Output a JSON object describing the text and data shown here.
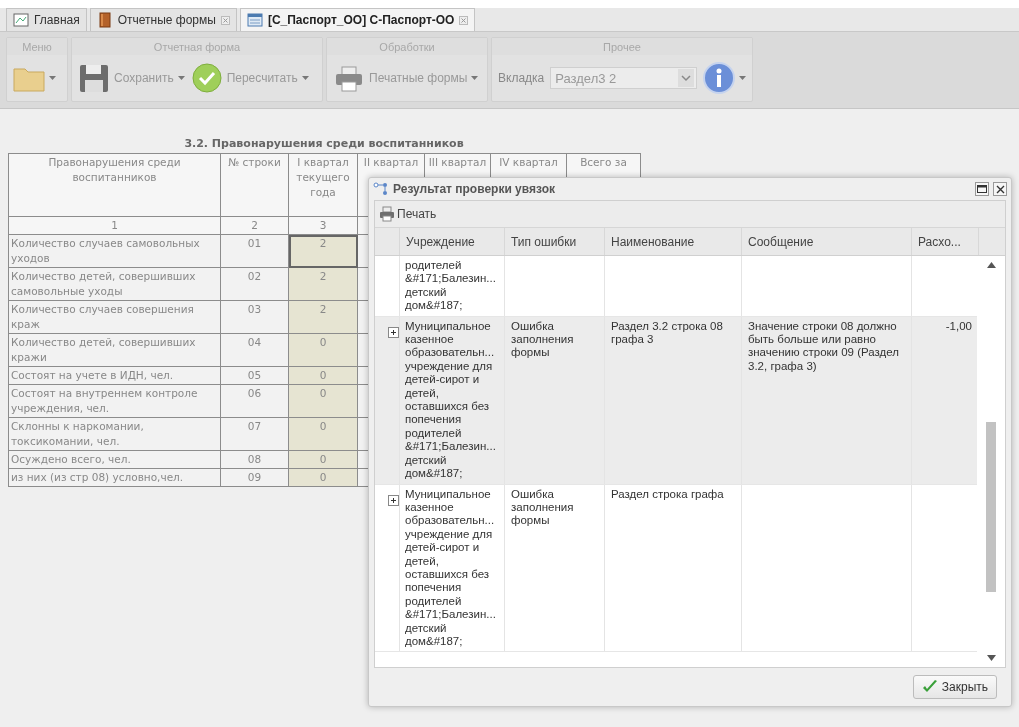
{
  "tabs": [
    {
      "label": "Главная",
      "selected": false,
      "closable": false
    },
    {
      "label": "Отчетные формы",
      "selected": false,
      "closable": true
    },
    {
      "label": "[C_Паспорт_ОО] С-Паспорт-ОО",
      "selected": true,
      "closable": true
    }
  ],
  "toolbar": {
    "groups": [
      {
        "title": "Меню",
        "items": [
          {
            "kind": "menu"
          }
        ]
      },
      {
        "title": "Отчетная форма",
        "items": [
          {
            "kind": "button",
            "label": "Сохранить"
          },
          {
            "kind": "button",
            "label": "Пересчитать"
          }
        ]
      },
      {
        "title": "Обработки",
        "items": [
          {
            "kind": "button",
            "label": "Печатные формы"
          }
        ]
      },
      {
        "title": "Прочее",
        "items": [
          {
            "kind": "combo",
            "label": "Вкладка",
            "value": "Раздел3 2"
          },
          {
            "kind": "info"
          }
        ]
      }
    ]
  },
  "form": {
    "title": "3.2. Правонарушения среди воспитанников",
    "columns": [
      "Правонарушения среди воспитанников",
      "№ строки",
      "I квартал текущего года",
      "II квартал",
      "III квартал",
      "IV квартал",
      "Всего за"
    ],
    "column_numbers": [
      "1",
      "2",
      "3"
    ],
    "rows": [
      {
        "label": "Количество случаев самовольных уходов",
        "number": "01",
        "value": "2",
        "focused": true
      },
      {
        "label": "Количество детей, совершивших самовольные уходы",
        "number": "02",
        "value": "2",
        "focused": false
      },
      {
        "label": "Количество случаев совершения краж",
        "number": "03",
        "value": "2",
        "focused": false
      },
      {
        "label": "Количество детей, совершивших кражи",
        "number": "04",
        "value": "0",
        "focused": false
      },
      {
        "label": "Состоят на учете в ИДН, чел.",
        "number": "05",
        "value": "0",
        "focused": false
      },
      {
        "label": "Состоят на внутреннем контроле учреждения, чел.",
        "number": "06",
        "value": "0",
        "focused": false
      },
      {
        "label": "Склонны к наркомании, токсикомании, чел.",
        "number": "07",
        "value": "0",
        "focused": false
      },
      {
        "label": "Осуждено всего, чел.",
        "number": "08",
        "value": "0",
        "focused": false
      },
      {
        "label": "из них (из стр 08) условно,чел.",
        "number": "09",
        "value": "0",
        "focused": false
      }
    ]
  },
  "dialog": {
    "title": "Результат проверки увязок",
    "print_button": "Печать",
    "columns": [
      "Учреждение",
      "Тип ошибки",
      "Наименование",
      "Сообщение",
      "Расхо..."
    ],
    "rows": [
      {
        "kind": "partial",
        "selected": false,
        "institution": "родителей\n&#171;Балезин...\nдетский\nдом&#187;"
      },
      {
        "kind": "full",
        "selected": true,
        "institution": "Муниципальное\nказенное\nобразовательн...\nучреждение для\nдетей-сирот и\nдетей,\nоставшихся без\nпопечения\nродителей\n&#171;Балезин...\nдетский\nдом&#187;",
        "error_type": "Ошибка заполнения формы",
        "name": "Раздел 3.2 строка 08 графа 3",
        "message": "Значение строки 08 должно быть больше или равно значению строки 09 (Раздел 3.2, графа 3)",
        "discrepancy": "-1,00"
      },
      {
        "kind": "full",
        "selected": false,
        "institution": "Муниципальное\nказенное\nобразовательн...\nучреждение для\nдетей-сирот и\nдетей,\nоставшихся без\nпопечения\nродителей\n&#171;Балезин...\nдетский\nдом&#187;",
        "error_type": "Ошибка заполнения формы",
        "name": "Раздел строка графа"
      }
    ],
    "close_button": "Закрыть"
  }
}
